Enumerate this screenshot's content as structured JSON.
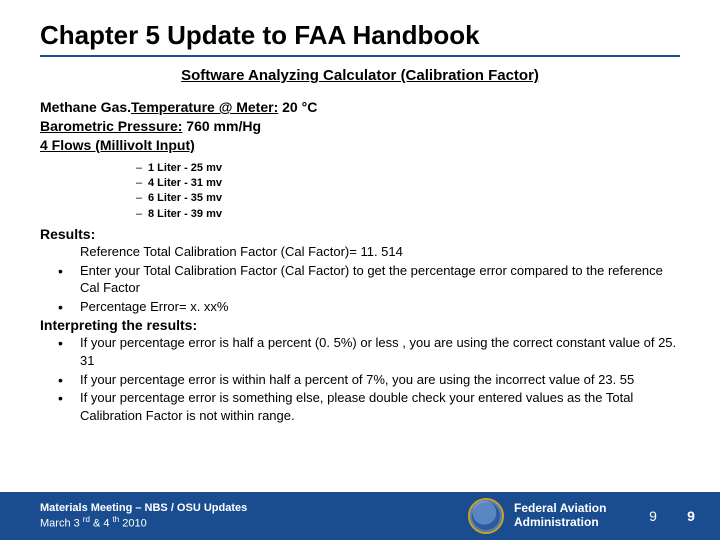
{
  "title": "Chapter 5 Update to FAA Handbook",
  "subtitle": "Software Analyzing Calculator (Calibration Factor)",
  "intro": {
    "line1a": "Methane  Gas.",
    "line1b": "Temperature @ Meter:",
    "line1c": " 20 °C",
    "line2a": "Barometric Pressure:",
    "line2b": " 760 mm/Hg",
    "line3": "4 Flows (Millivolt Input)"
  },
  "flows": [
    "1 Liter - 25 mv",
    "4 Liter - 31 mv",
    "6 Liter - 35 mv",
    "8 Liter - 39 mv"
  ],
  "results_hd": "Results:",
  "results": [
    "Reference Total Calibration Factor (Cal Factor)= 11. 514",
    "Enter your Total Calibration Factor (Cal Factor) to get the percentage error compared to the reference Cal Factor",
    "Percentage Error= x. xx%"
  ],
  "interp_hd": "Interpreting the results:",
  "interp": [
    "If your percentage error is half a percent (0. 5%) or less , you are using the correct constant value of 25. 31",
    "If your percentage error is within half a percent of 7%, you are using the incorrect value of 23. 55",
    "If your percentage error is something else, please double check your entered values as the Total Calibration Factor is not within range."
  ],
  "footer": {
    "meeting": "Materials Meeting – NBS / OSU Updates",
    "date_a": "March 3 ",
    "date_b": "rd",
    "date_c": " & 4 ",
    "date_d": "th",
    "date_e": " 2010",
    "org1": "Federal Aviation",
    "org2": "Administration",
    "page1": "9",
    "page2": "9"
  }
}
